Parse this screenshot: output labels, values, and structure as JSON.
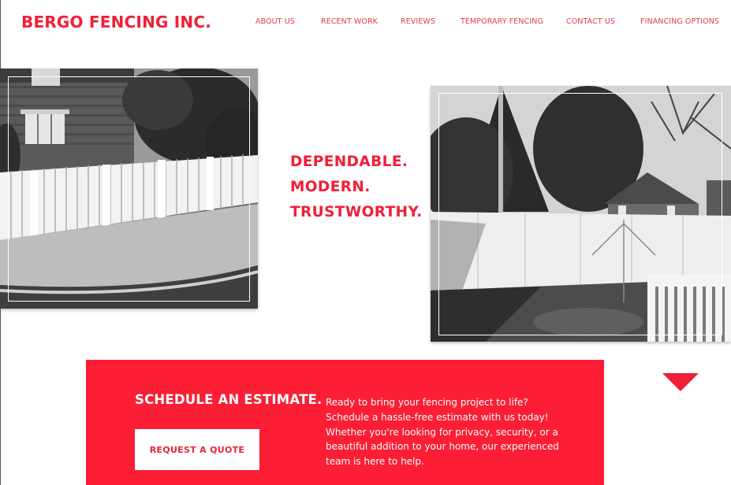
{
  "header": {
    "logo_text": "BERGO FENCING INC.",
    "nav": [
      {
        "label": "ABOUT US"
      },
      {
        "label": "RECENT WORK"
      },
      {
        "label": "REVIEWS"
      },
      {
        "label": "TEMPORARY FENCING"
      },
      {
        "label": "CONTACT US"
      },
      {
        "label": "FINANCING OPTIONS"
      }
    ]
  },
  "hero": {
    "tagline": [
      "DEPENDABLE.",
      "MODERN.",
      "TRUSTWORTHY."
    ]
  },
  "estimate": {
    "title": "SCHEDULE AN ESTIMATE.",
    "button_label": "REQUEST A QUOTE",
    "description": "Ready to bring your fencing project to life? Schedule a hassle-free estimate with us today! Whether you're looking for privacy, security, or a beautiful addition to your home, our experienced team is here to help."
  },
  "colors": {
    "accent": "#f21e36",
    "cta_background": "#fb1e35",
    "background": "#ffffff"
  },
  "icons": {
    "scroll_arrow": "triangle-down-icon"
  }
}
